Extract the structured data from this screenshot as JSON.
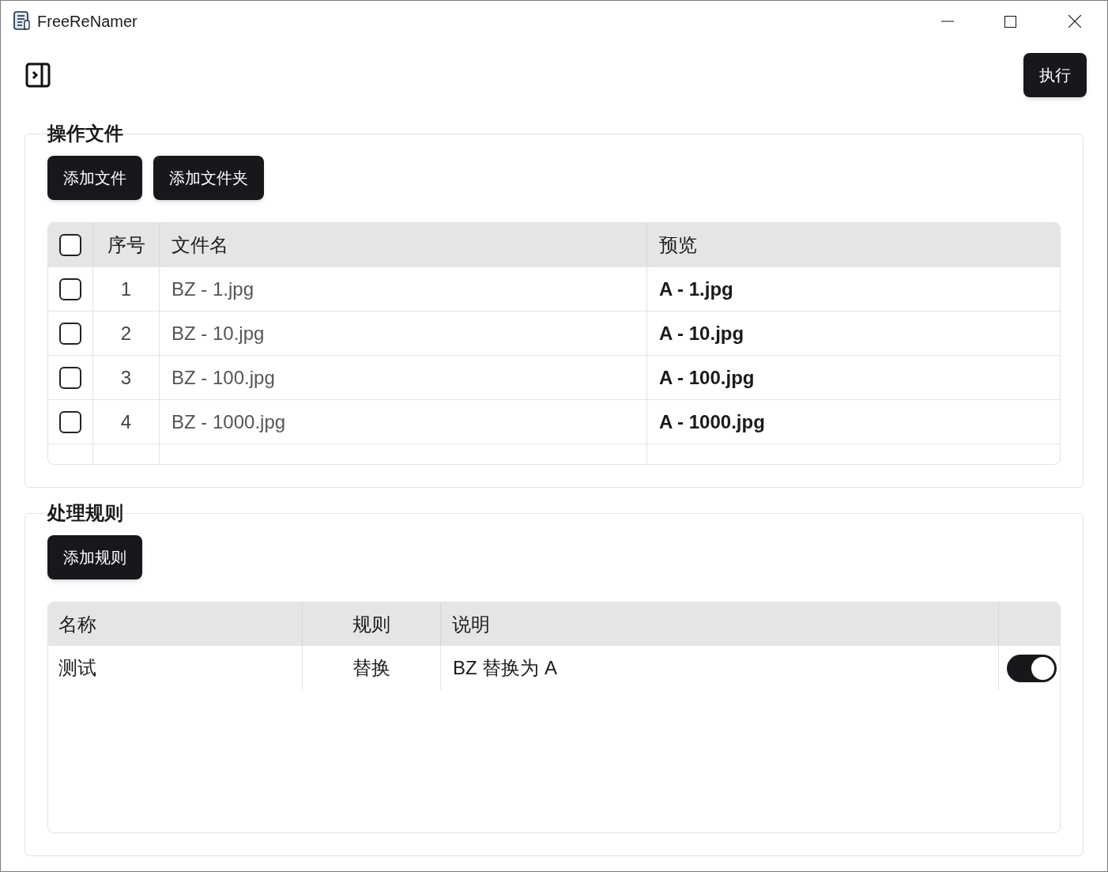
{
  "window": {
    "title": "FreeReNamer"
  },
  "toolbar": {
    "execute_button": "执行"
  },
  "files_section": {
    "legend": "操作文件",
    "buttons": [
      "添加文件",
      "添加文件夹"
    ],
    "table": {
      "select_all": {
        "checked": false
      },
      "columns": [
        "序号",
        "文件名",
        "预览"
      ],
      "rows": [
        {
          "checked": false,
          "index": "1",
          "name": "BZ - 1.jpg",
          "preview": "A - 1.jpg"
        },
        {
          "checked": false,
          "index": "2",
          "name": "BZ - 10.jpg",
          "preview": "A - 10.jpg"
        },
        {
          "checked": false,
          "index": "3",
          "name": "BZ - 100.jpg",
          "preview": "A - 100.jpg"
        },
        {
          "checked": false,
          "index": "4",
          "name": "BZ - 1000.jpg",
          "preview": "A - 1000.jpg"
        }
      ]
    }
  },
  "rules_section": {
    "legend": "处理规则",
    "buttons": [
      "添加规则"
    ],
    "table": {
      "columns": [
        "名称",
        "规则",
        "说明"
      ],
      "rows": [
        {
          "name": "测试",
          "rule": "替换",
          "description": "BZ 替换为 A",
          "on": true
        }
      ]
    }
  }
}
